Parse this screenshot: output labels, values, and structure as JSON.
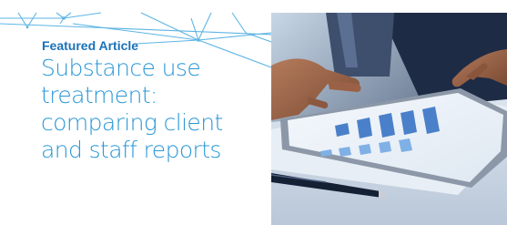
{
  "eyebrow": "Featured Article",
  "headline_lines": [
    "Substance use",
    "treatment:",
    "comparing client",
    "and staff reports"
  ],
  "colors": {
    "eyebrow": "#1a72b8",
    "headline": "#2a97d6",
    "network_lines": "#5eb5e4"
  },
  "photo": {
    "icon": "tablet-chart-photo",
    "subject": "hands using a tablet showing a bar chart, with a pen on a desk"
  }
}
